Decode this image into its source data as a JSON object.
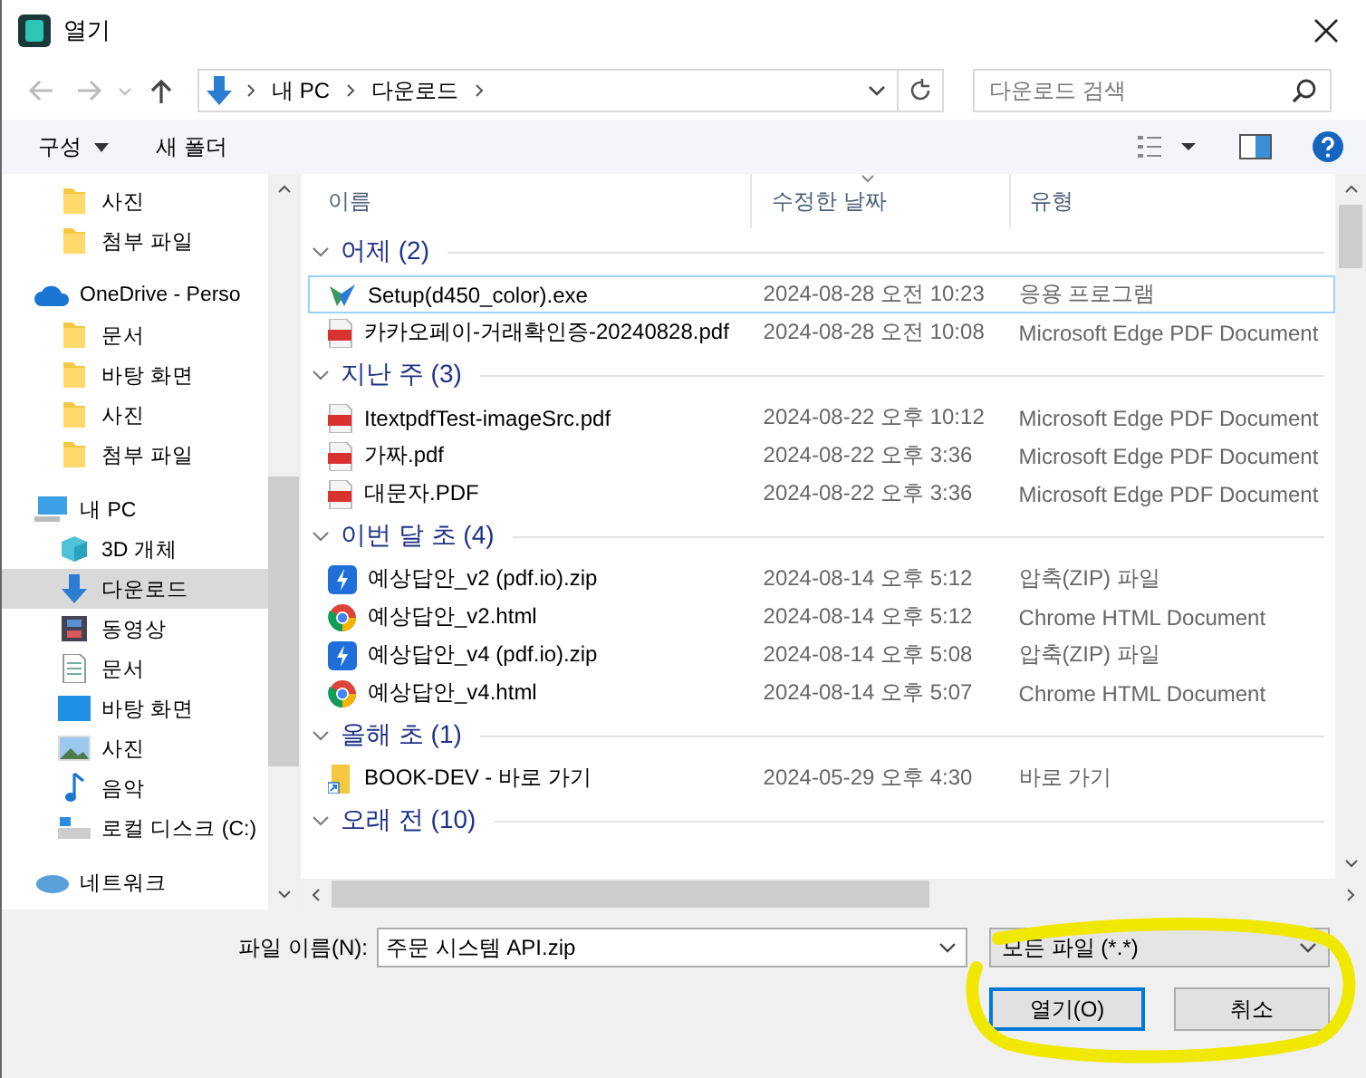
{
  "window": {
    "title": "열기"
  },
  "nav": {
    "path": [
      "내 PC",
      "다운로드"
    ],
    "search": {
      "placeholder": "다운로드 검색"
    }
  },
  "toolbar": {
    "organize": "구성",
    "new_folder": "새 폴더"
  },
  "sidebar": {
    "items": [
      {
        "children": [
          {
            "label": "사진",
            "kind": "folder",
            "selected": false
          },
          {
            "label": "첨부 파일",
            "kind": "folder",
            "selected": false
          }
        ]
      },
      {
        "label": "OneDrive - Perso",
        "kind": "cloud",
        "selected": false,
        "children": [
          {
            "label": "문서",
            "kind": "folder",
            "selected": false
          },
          {
            "label": "바탕 화면",
            "kind": "folder",
            "selected": false
          },
          {
            "label": "사진",
            "kind": "folder",
            "selected": false
          },
          {
            "label": "첨부 파일",
            "kind": "folder",
            "selected": false
          }
        ]
      },
      {
        "label": "내 PC",
        "kind": "pc",
        "selected": false,
        "children": [
          {
            "label": "3D 개체",
            "kind": "cube",
            "selected": false
          },
          {
            "label": "다운로드",
            "kind": "download",
            "selected": true
          },
          {
            "label": "동영상",
            "kind": "video",
            "selected": false
          },
          {
            "label": "문서",
            "kind": "doc",
            "selected": false
          },
          {
            "label": "바탕 화면",
            "kind": "desktop",
            "selected": false
          },
          {
            "label": "사진",
            "kind": "picture",
            "selected": false
          },
          {
            "label": "음악",
            "kind": "music",
            "selected": false
          },
          {
            "label": "로컬 디스크 (C:)",
            "kind": "drive",
            "selected": false
          }
        ]
      },
      {
        "label": "네트워크",
        "kind": "network",
        "selected": false
      }
    ]
  },
  "list": {
    "columns": [
      {
        "label": "이름",
        "sorted": false
      },
      {
        "label": "수정한 날짜",
        "sorted": true
      },
      {
        "label": "유형",
        "sorted": false
      }
    ],
    "groups": [
      {
        "name": "어제 (2)",
        "expanded": true,
        "files": [
          {
            "name": "Setup(d450_color).exe",
            "date": "2024-08-28 오전 10:23",
            "type": "응용 프로그램",
            "kind": "setup",
            "selected": true
          },
          {
            "name": "카카오페이-거래확인증-20240828.pdf",
            "date": "2024-08-28 오전 10:08",
            "type": "Microsoft Edge PDF Document",
            "kind": "pdf",
            "selected": false
          }
        ]
      },
      {
        "name": "지난 주 (3)",
        "expanded": true,
        "files": [
          {
            "name": "ItextpdfTest-imageSrc.pdf",
            "date": "2024-08-22 오후 10:12",
            "type": "Microsoft Edge PDF Document",
            "kind": "pdf",
            "selected": false
          },
          {
            "name": "가짜.pdf",
            "date": "2024-08-22 오후 3:36",
            "type": "Microsoft Edge PDF Document",
            "kind": "pdf",
            "selected": false
          },
          {
            "name": "대문자.PDF",
            "date": "2024-08-22 오후 3:36",
            "type": "Microsoft Edge PDF Document",
            "kind": "pdf",
            "selected": false
          }
        ]
      },
      {
        "name": "이번 달 초 (4)",
        "expanded": true,
        "files": [
          {
            "name": "예상답안_v2 (pdf.io).zip",
            "date": "2024-08-14 오후 5:12",
            "type": "압축(ZIP) 파일",
            "kind": "zip",
            "selected": false
          },
          {
            "name": "예상답안_v2.html",
            "date": "2024-08-14 오후 5:12",
            "type": "Chrome HTML Document",
            "kind": "chrome",
            "selected": false
          },
          {
            "name": "예상답안_v4 (pdf.io).zip",
            "date": "2024-08-14 오후 5:08",
            "type": "압축(ZIP) 파일",
            "kind": "zip",
            "selected": false
          },
          {
            "name": "예상답안_v4.html",
            "date": "2024-08-14 오후 5:07",
            "type": "Chrome HTML Document",
            "kind": "chrome",
            "selected": false
          }
        ]
      },
      {
        "name": "올해 초 (1)",
        "expanded": true,
        "files": [
          {
            "name": "BOOK-DEV - 바로 가기",
            "date": "2024-05-29 오후 4:30",
            "type": "바로 가기",
            "kind": "shortcut",
            "selected": false
          }
        ]
      },
      {
        "name": "오래 전 (10)",
        "expanded": true
      }
    ]
  },
  "footer": {
    "filename_label": "파일 이름(N):",
    "filename": "주문 시스템 API.zip",
    "filter": "모든 파일 (*.*)",
    "buttons": [
      {
        "label": "열기(O)",
        "default": true
      },
      {
        "label": "취소",
        "default": false
      }
    ]
  }
}
